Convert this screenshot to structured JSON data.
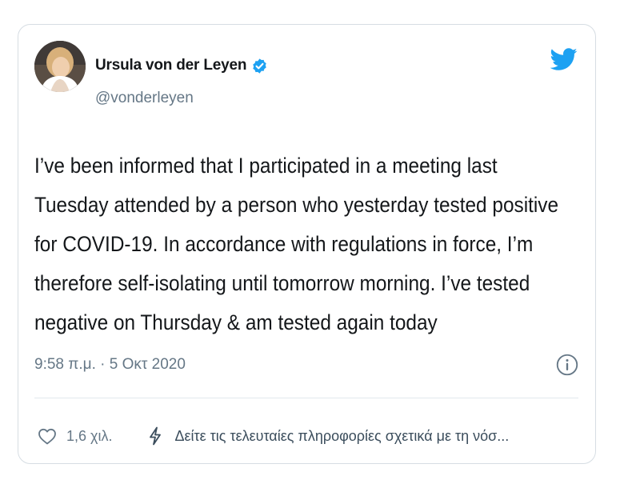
{
  "tweet": {
    "author": {
      "display_name": "Ursula von der Leyen",
      "handle": "@vonderleyen",
      "verified": true,
      "avatar_icon": "profile-photo"
    },
    "text_lines": [
      "I’ve been informed that I participated in a meeting last",
      "Tuesday attended by a person who yesterday tested positive",
      "for COVID-19. In accordance with regulations in force, I’m",
      "therefore self-isolating until tomorrow morning. I’ve tested",
      "negative on Thursday & am tested again today"
    ],
    "timestamp": "9:58 π.μ. · 5 Οκτ 2020",
    "info_icon": "info-icon",
    "like_count": "1,6 χιλ.",
    "covid_link": "Δείτε τις τελευταίες πληροφορίες σχετικά με τη νόσ..."
  },
  "icons": {
    "brand": "twitter-bird-icon",
    "verified": "verified-badge-icon",
    "like": "heart-outline-icon",
    "covid": "lightning-bolt-icon"
  },
  "colors": {
    "brand_blue": "#1da1f2",
    "text_primary": "#14171a",
    "text_secondary": "#657786",
    "border": "#d6dde3"
  }
}
